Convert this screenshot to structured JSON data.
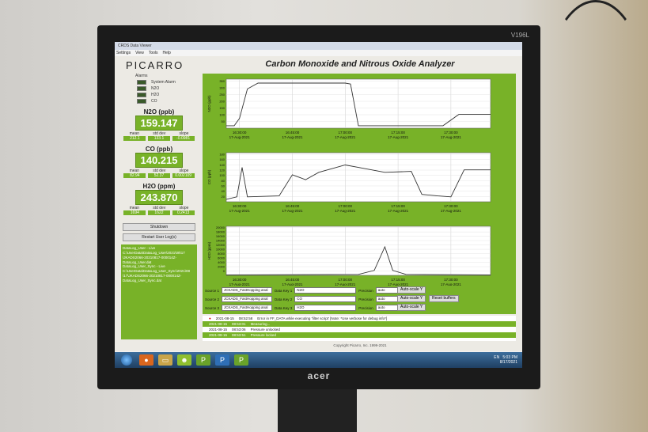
{
  "monitor": {
    "model": "V196L",
    "brand": "acer"
  },
  "window": {
    "title": "CRDS Data Viewer",
    "menu": [
      "Settings",
      "View",
      "Tools",
      "Help"
    ]
  },
  "logo": "PICARRO",
  "app_title": "Carbon Monoxide and Nitrous Oxide Analyzer",
  "alarms": {
    "title": "Alarms",
    "items": [
      "System Alarm",
      "N2O",
      "H2O",
      "CO"
    ]
  },
  "measurements": [
    {
      "label": "N2O (ppb)",
      "value": "159.147",
      "stats": [
        "mean",
        "std dev",
        "slope"
      ],
      "stat_values": [
        "212.1",
        "133.1",
        "-0.0981"
      ]
    },
    {
      "label": "CO (ppb)",
      "value": "140.215",
      "stats": [
        "mean",
        "std dev",
        "slope"
      ],
      "stat_values": [
        "82.94",
        "52.37",
        "0.002109"
      ]
    },
    {
      "label": "H2O (ppm)",
      "value": "243.870",
      "stats": [
        "mean",
        "std dev",
        "slope"
      ],
      "stat_values": [
        "1694",
        "1622",
        "0.2413"
      ]
    }
  ],
  "buttons": {
    "shutdown": "Shutdown",
    "restart_log": "Restart User Log(s)",
    "reset_buffers": "Reset buffers",
    "autoscale": "Auto-scale Y"
  },
  "log_lines": [
    "DataLog_User - Live",
    "C:\\UserData\\DataLog_User\\2021\\08\\17",
    "\\JKADS2066-20210817-000014Z-",
    "DataLog_User.dat",
    "DataLog_User_Sync - Live",
    "C:\\UserData\\DataLog_User_Sync\\2021\\08",
    "\\17\\JKADS2066-20210817-000014Z-",
    "DataLog_User_Sync.dat"
  ],
  "plots": [
    {
      "ylabel": "N2O (ppb)",
      "yticks": [
        "50",
        "100",
        "150",
        "200",
        "250",
        "300",
        "350"
      ]
    },
    {
      "ylabel": "CO (ppb)",
      "yticks": [
        "20",
        "40",
        "60",
        "80",
        "100",
        "120",
        "140",
        "160",
        "180"
      ]
    },
    {
      "ylabel": "H2O (ppm)",
      "yticks": [
        "0",
        "2000",
        "4000",
        "6000",
        "8000",
        "10000",
        "12000",
        "14000",
        "16000",
        "18000",
        "20000"
      ]
    }
  ],
  "xticks": [
    {
      "time": "16:30:00",
      "date": "17-Aug-2021"
    },
    {
      "time": "16:45:00",
      "date": "17-Aug-2021"
    },
    {
      "time": "17:00:00",
      "date": "17-Aug-2021"
    },
    {
      "time": "17:15:00",
      "date": "17-Aug-2021"
    },
    {
      "time": "17:30:00",
      "date": "17-Aug-2021"
    }
  ],
  "controls": [
    {
      "source_label": "Source 1",
      "source": "JCKADS_FastHopping anal",
      "key_label": "Data Key 1",
      "key": "N2O",
      "precision_label": "Precision",
      "precision": "auto"
    },
    {
      "source_label": "Source 2",
      "source": "JCKADS_FastHopping anal",
      "key_label": "Data Key 2",
      "key": "CO",
      "precision_label": "Precision",
      "precision": "auto"
    },
    {
      "source_label": "Source 3",
      "source": "JCKADS_FastHopping anal",
      "key_label": "Data Key 3",
      "key": "H2O",
      "precision_label": "Precision",
      "precision": "auto"
    }
  ],
  "messages": [
    {
      "date": "2021-08-15",
      "time": "08:52:58",
      "text": "Error in FF_DATA while executing 'filter script' [Note: *Use verbose for debug info*]"
    },
    {
      "date": "2021-08-15",
      "time": "08:53:01",
      "text": "Measuring..."
    },
    {
      "date": "2021-08-15",
      "time": "08:53:06",
      "text": "Pressure unlocked"
    },
    {
      "date": "2021-08-15",
      "time": "08:53:51",
      "text": "Pressure locked"
    }
  ],
  "copyright": "Copyright Picarro, Inc. 1999-2021",
  "tray": {
    "lang": "EN",
    "time": "5:03 PM",
    "date": "8/17/2021"
  },
  "colors": {
    "accent_green": "#78b228",
    "plot_bg": "#ffffff",
    "line": "#333333"
  }
}
